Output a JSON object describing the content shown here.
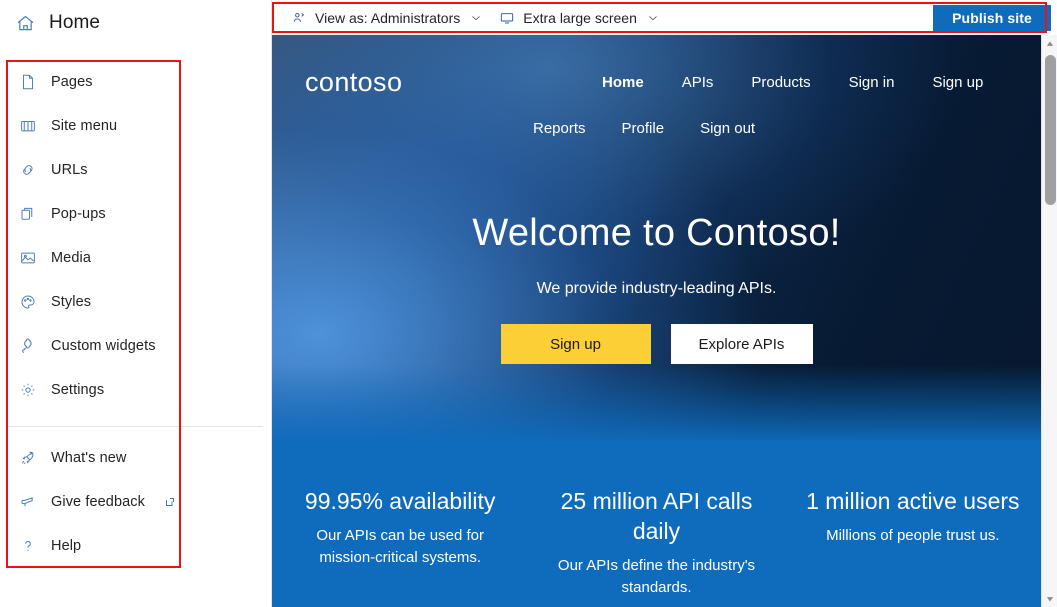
{
  "header": {
    "title": "Home",
    "icon": "home-icon"
  },
  "sidebar": {
    "items": [
      {
        "label": "Pages",
        "icon": "page-icon"
      },
      {
        "label": "Site menu",
        "icon": "book-icon"
      },
      {
        "label": "URLs",
        "icon": "link-icon"
      },
      {
        "label": "Pop-ups",
        "icon": "copy-icon"
      },
      {
        "label": "Media",
        "icon": "image-icon"
      },
      {
        "label": "Styles",
        "icon": "palette-icon"
      },
      {
        "label": "Custom widgets",
        "icon": "puzzle-icon"
      },
      {
        "label": "Settings",
        "icon": "gear-icon"
      }
    ],
    "footer_items": [
      {
        "label": "What's new",
        "icon": "rocket-icon",
        "external": false
      },
      {
        "label": "Give feedback",
        "icon": "megaphone-icon",
        "external": true
      },
      {
        "label": "Help",
        "icon": "question-icon",
        "external": false
      }
    ]
  },
  "toolbar": {
    "view_as": {
      "label": "View as: Administrators",
      "icon": "person-icon",
      "chevron": "chevron-down-icon"
    },
    "screen_size": {
      "label": "Extra large screen",
      "icon": "monitor-icon",
      "chevron": "chevron-down-icon"
    },
    "publish_label": "Publish site",
    "publish_color": "#0f6cbd"
  },
  "preview": {
    "brand": "contoso",
    "nav_primary": [
      {
        "label": "Home",
        "active": true
      },
      {
        "label": "APIs",
        "active": false
      },
      {
        "label": "Products",
        "active": false
      },
      {
        "label": "Sign in",
        "active": false
      },
      {
        "label": "Sign up",
        "active": false
      }
    ],
    "nav_secondary": [
      {
        "label": "Reports",
        "active": false
      },
      {
        "label": "Profile",
        "active": false
      },
      {
        "label": "Sign out",
        "active": false
      }
    ],
    "hero": {
      "title": "Welcome to Contoso!",
      "subtitle": "We provide industry-leading APIs.",
      "primary_button": "Sign up",
      "secondary_button": "Explore APIs",
      "primary_button_color": "#fbcf35",
      "secondary_button_color": "#ffffff"
    },
    "stats": [
      {
        "value": "99.95% availability",
        "desc": "Our APIs can be used for mission-critical systems."
      },
      {
        "value": "25 million API calls daily",
        "desc": "Our APIs define the industry's standards."
      },
      {
        "value": "1 million active users",
        "desc": "Millions of people trust us."
      }
    ],
    "stats_band_color": "#0f6cbd"
  },
  "scrollbar": {
    "up_icon": "caret-up-icon",
    "down_icon": "caret-down-icon"
  },
  "annotations": {
    "color": "#ee1111"
  }
}
